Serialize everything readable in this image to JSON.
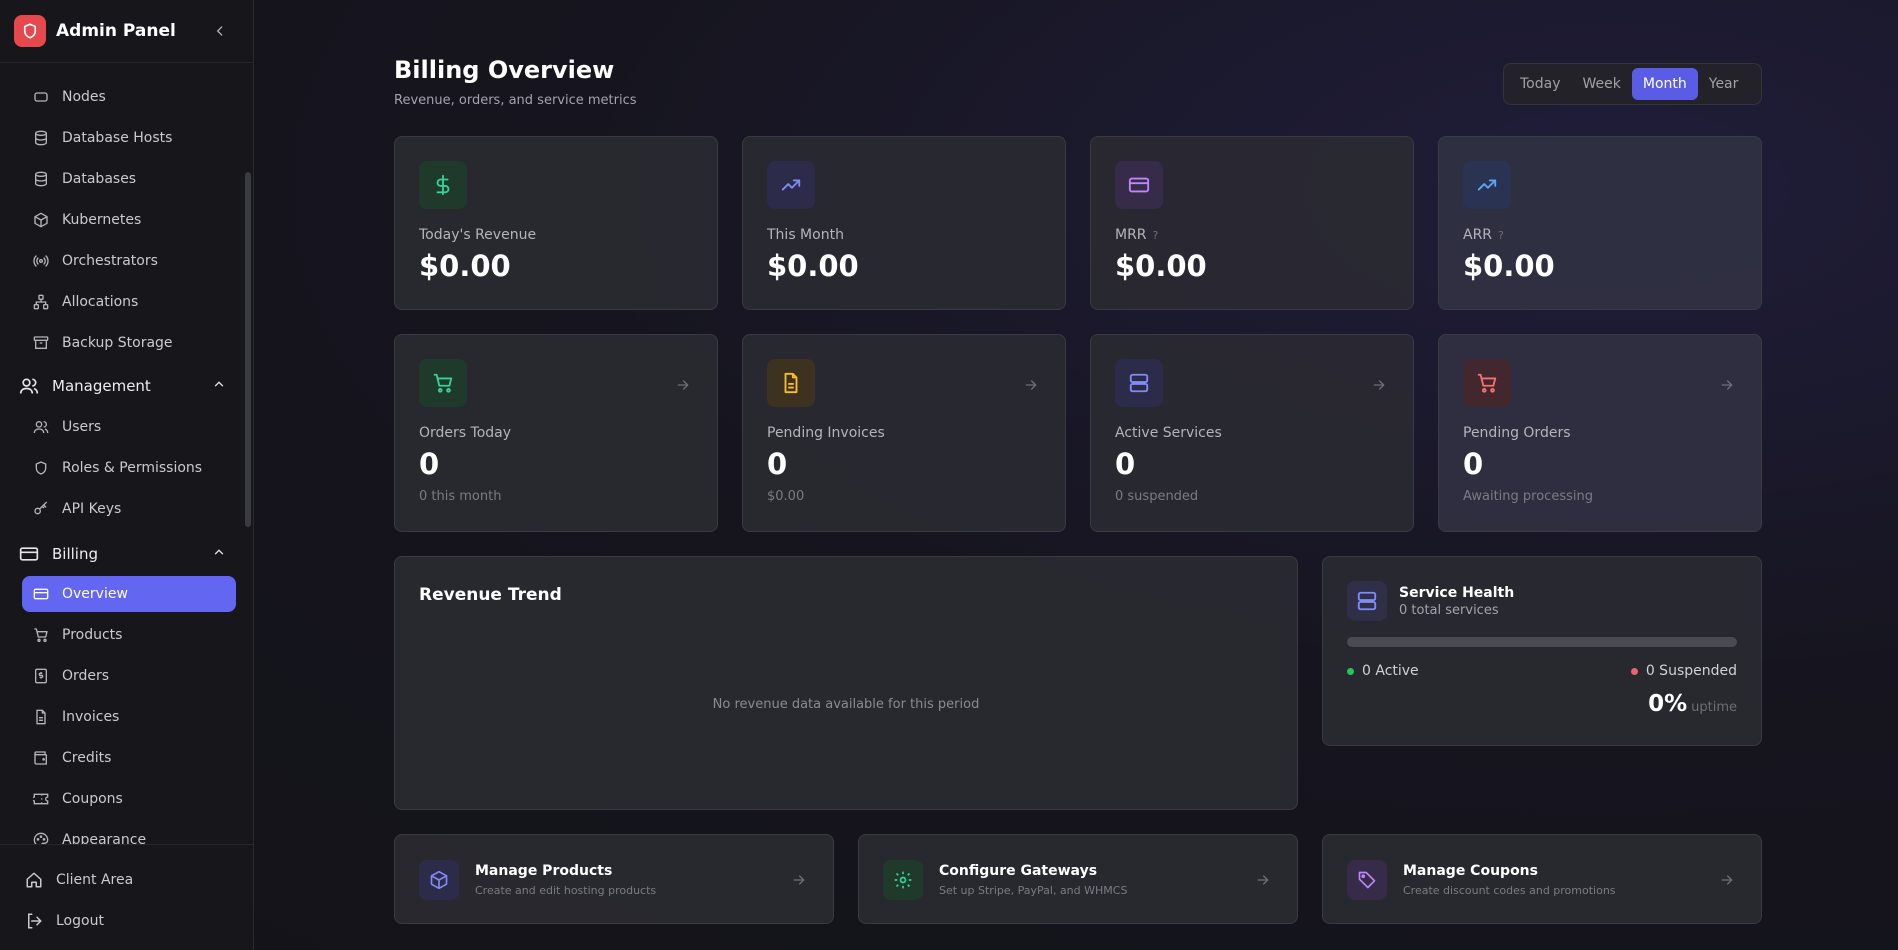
{
  "brand": {
    "title": "Admin Panel"
  },
  "sidebar": {
    "items_top": [
      {
        "label": "Nodes",
        "icon": "server-icon"
      },
      {
        "label": "Database Hosts",
        "icon": "database-icon"
      },
      {
        "label": "Databases",
        "icon": "database-icon"
      },
      {
        "label": "Kubernetes",
        "icon": "cube-icon"
      },
      {
        "label": "Orchestrators",
        "icon": "radio-icon"
      },
      {
        "label": "Allocations",
        "icon": "network-icon"
      },
      {
        "label": "Backup Storage",
        "icon": "archive-icon"
      }
    ],
    "management": {
      "label": "Management",
      "items": [
        {
          "label": "Users",
          "icon": "users-icon"
        },
        {
          "label": "Roles & Permissions",
          "icon": "shield-icon"
        },
        {
          "label": "API Keys",
          "icon": "key-icon"
        }
      ]
    },
    "billing": {
      "label": "Billing",
      "items": [
        {
          "label": "Overview",
          "icon": "card-icon",
          "active": true
        },
        {
          "label": "Products",
          "icon": "cart-icon"
        },
        {
          "label": "Orders",
          "icon": "dollar-receipt-icon"
        },
        {
          "label": "Invoices",
          "icon": "file-icon"
        },
        {
          "label": "Credits",
          "icon": "wallet-icon"
        },
        {
          "label": "Coupons",
          "icon": "ticket-icon"
        },
        {
          "label": "Appearance",
          "icon": "palette-icon"
        }
      ]
    },
    "footer": [
      {
        "label": "Client Area",
        "icon": "home-icon"
      },
      {
        "label": "Logout",
        "icon": "logout-icon"
      }
    ]
  },
  "header": {
    "title": "Billing Overview",
    "subtitle": "Revenue, orders, and service metrics"
  },
  "range": {
    "options": [
      "Today",
      "Week",
      "Month",
      "Year"
    ],
    "selected": "Month"
  },
  "stats_row1": [
    {
      "label": "Today's Revenue",
      "value": "$0.00",
      "icon": "dollar-icon"
    },
    {
      "label": "This Month",
      "value": "$0.00",
      "icon": "trending-up-icon"
    },
    {
      "label": "MRR",
      "value": "$0.00",
      "icon": "card-icon"
    },
    {
      "label": "ARR",
      "value": "$0.00",
      "icon": "trending-up-icon"
    }
  ],
  "stats_row2": [
    {
      "label": "Orders Today",
      "value": "0",
      "sub": "0 this month",
      "icon": "cart-icon"
    },
    {
      "label": "Pending Invoices",
      "value": "0",
      "sub": "$0.00",
      "icon": "file-icon"
    },
    {
      "label": "Active Services",
      "value": "0",
      "sub": "0 suspended",
      "icon": "server-icon"
    },
    {
      "label": "Pending Orders",
      "value": "0",
      "sub": "Awaiting processing",
      "icon": "cart-icon"
    }
  ],
  "revenue_trend": {
    "title": "Revenue Trend",
    "empty_text": "No revenue data available for this period"
  },
  "service_health": {
    "title": "Service Health",
    "subtitle": "0 total services",
    "active_label": "0 Active",
    "suspended_label": "0 Suspended",
    "uptime_value": "0%",
    "uptime_label": "uptime",
    "active_fraction": 0
  },
  "actions": [
    {
      "title": "Manage Products",
      "sub": "Create and edit hosting products",
      "icon": "cube-icon"
    },
    {
      "title": "Configure Gateways",
      "sub": "Set up Stripe, PayPal, and WHMCS",
      "icon": "gear-icon"
    },
    {
      "title": "Manage Coupons",
      "sub": "Create discount codes and promotions",
      "icon": "tag-icon"
    }
  ],
  "colors": {
    "accent": "#6366f1",
    "green": "#22c55e",
    "red": "#ef4444",
    "yellow": "#eab308",
    "purple": "#a78bfa",
    "blue": "#60a5fa"
  }
}
